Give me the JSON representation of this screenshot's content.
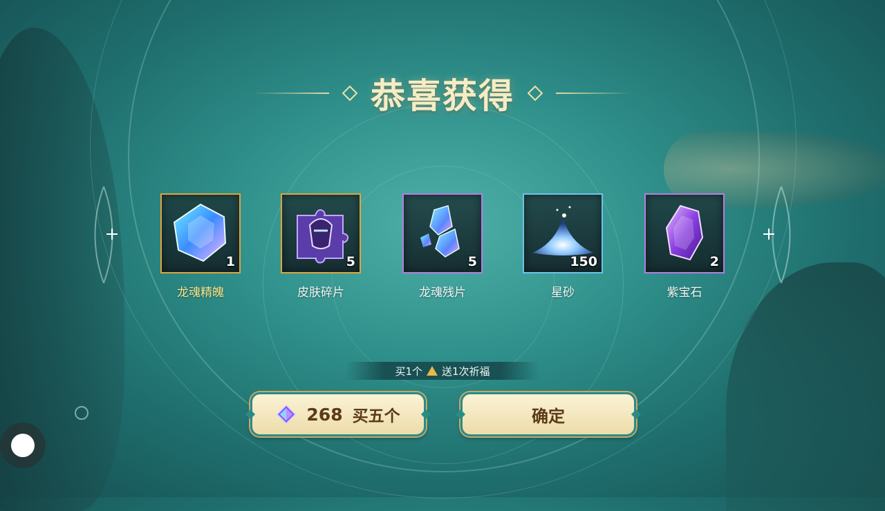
{
  "title": "恭喜获得",
  "items": [
    {
      "name": "龙魂精魄",
      "count": "1",
      "rarity": "gold",
      "icon": "dragon-soul-essence-icon"
    },
    {
      "name": "皮肤碎片",
      "count": "5",
      "rarity": "gold",
      "icon": "skin-fragment-icon"
    },
    {
      "name": "龙魂残片",
      "count": "5",
      "rarity": "purple",
      "icon": "dragon-soul-shard-icon"
    },
    {
      "name": "星砂",
      "count": "150",
      "rarity": "blue",
      "icon": "star-sand-icon"
    },
    {
      "name": "紫宝石",
      "count": "2",
      "rarity": "purple",
      "icon": "purple-gem-icon"
    }
  ],
  "bonus": {
    "prefix": "买1个",
    "suffix": "送1次祈福"
  },
  "buttons": {
    "buy_price": "268",
    "buy_label": "买五个",
    "confirm_label": "确定"
  }
}
